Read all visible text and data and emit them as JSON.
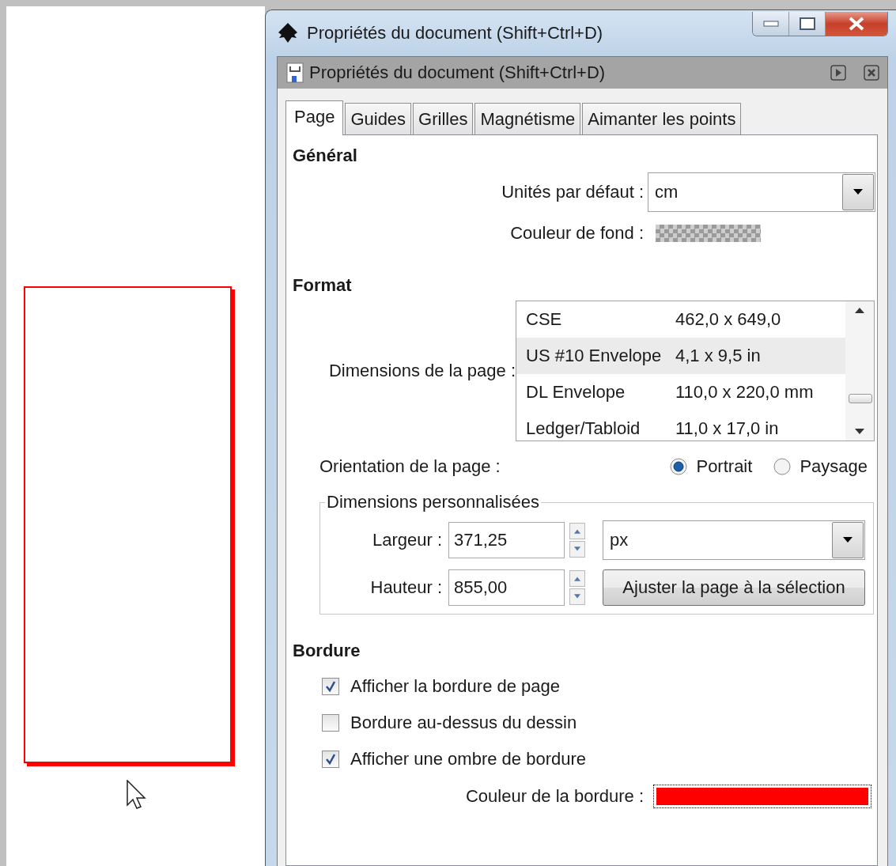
{
  "window": {
    "title": "Propriétés du document (Shift+Ctrl+D)"
  },
  "panel": {
    "title": "Propriétés du document (Shift+Ctrl+D)"
  },
  "tabs": [
    {
      "label": "Page",
      "selected": true
    },
    {
      "label": "Guides",
      "selected": false
    },
    {
      "label": "Grilles",
      "selected": false
    },
    {
      "label": "Magnétisme",
      "selected": false
    },
    {
      "label": "Aimanter les points",
      "selected": false
    }
  ],
  "general": {
    "heading": "Général",
    "units": {
      "label": "Unités par défaut :",
      "value": "cm"
    },
    "background": {
      "label": "Couleur de fond :"
    }
  },
  "format": {
    "heading": "Format",
    "size_label": "Dimensions de la page :",
    "sizes": [
      {
        "name": "CSE",
        "size": "462,0 x 649,0",
        "selected": false
      },
      {
        "name": "US #10 Envelope",
        "size": "4,1 x 9,5 in",
        "selected": true
      },
      {
        "name": "DL Envelope",
        "size": "110,0 x 220,0 mm",
        "selected": false
      },
      {
        "name": "Ledger/Tabloid",
        "size": "11,0 x 17,0 in",
        "selected": false
      }
    ],
    "orientation": {
      "label": "Orientation de la page :",
      "options": [
        {
          "label": "Portrait",
          "selected": true
        },
        {
          "label": "Paysage",
          "selected": false
        }
      ]
    },
    "custom": {
      "legend": "Dimensions personnalisées",
      "width": {
        "label": "Largeur :",
        "value": "371,25"
      },
      "height": {
        "label": "Hauteur :",
        "value": "855,00"
      },
      "unit": "px",
      "fit_button": "Ajuster la page à la sélection"
    }
  },
  "border": {
    "heading": "Bordure",
    "options": [
      {
        "label": "Afficher la bordure de page",
        "checked": true
      },
      {
        "label": "Bordure au-dessus du dessin",
        "checked": false
      },
      {
        "label": "Afficher une ombre de bordure",
        "checked": true
      }
    ],
    "color": {
      "label": "Couleur de la bordure :",
      "color": "#ff0000"
    }
  }
}
